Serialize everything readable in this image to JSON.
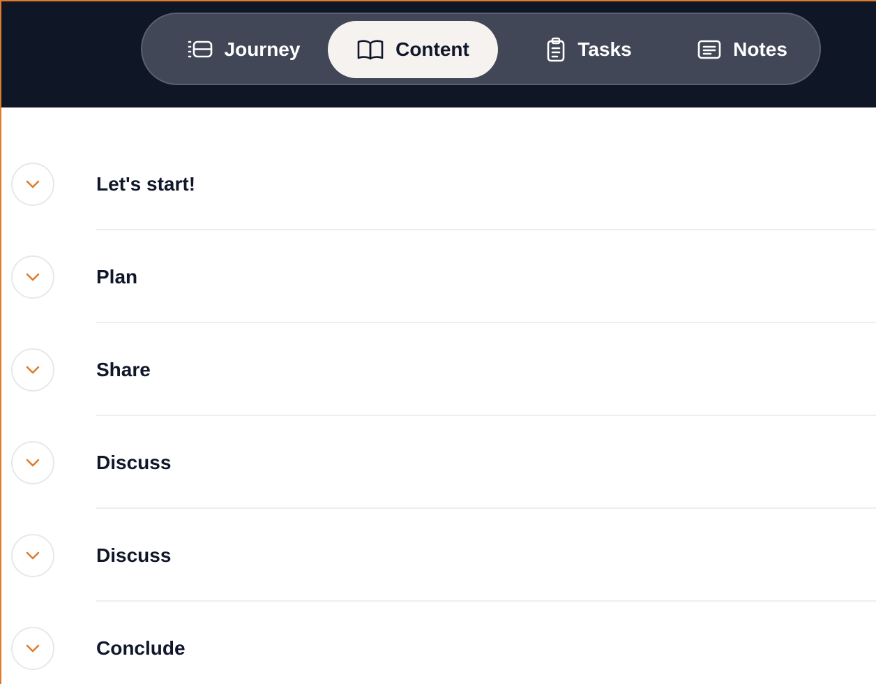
{
  "nav": {
    "tabs": [
      {
        "label": "Journey",
        "icon": "timeline-list-icon",
        "active": false
      },
      {
        "label": "Content",
        "icon": "open-book-icon",
        "active": true
      },
      {
        "label": "Tasks",
        "icon": "clipboard-icon",
        "active": false
      },
      {
        "label": "Notes",
        "icon": "note-card-icon",
        "active": false
      }
    ]
  },
  "sections": [
    {
      "label": "Let's start!",
      "icon": "chevron-down-icon"
    },
    {
      "label": "Plan",
      "icon": "chevron-down-icon"
    },
    {
      "label": "Share",
      "icon": "chevron-down-icon"
    },
    {
      "label": "Discuss",
      "icon": "chevron-down-icon"
    },
    {
      "label": "Discuss",
      "icon": "chevron-down-icon"
    },
    {
      "label": "Conclude",
      "icon": "chevron-down-icon"
    }
  ],
  "colors": {
    "header_bg": "#0f1626",
    "nav_pill_bg": "#414756",
    "active_tab_bg": "#f5f2ef",
    "accent": "#e07b2a"
  }
}
